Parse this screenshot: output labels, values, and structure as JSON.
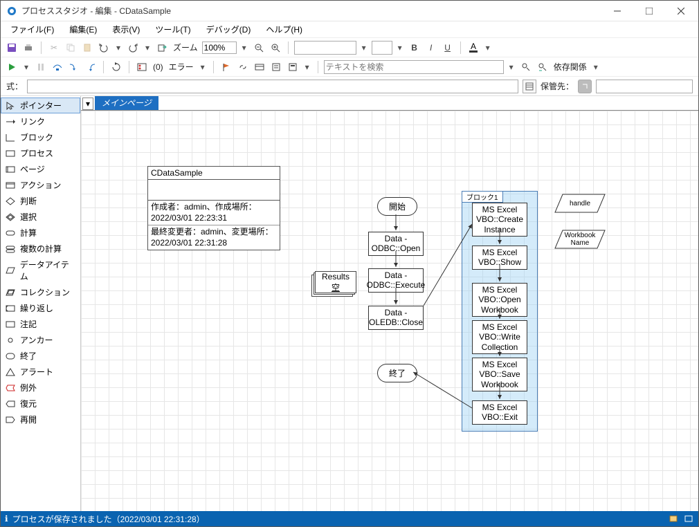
{
  "window": {
    "title": "プロセススタジオ - 編集 - CDataSample"
  },
  "menus": {
    "file": "ファイル(F)",
    "edit": "編集(E)",
    "view": "表示(V)",
    "tool": "ツール(T)",
    "debug": "デバッグ(D)",
    "help": "ヘルプ(H)"
  },
  "toolbar1": {
    "zoom_label": "ズーム",
    "zoom_value": "100%"
  },
  "toolbar2": {
    "bp_label": "(0)",
    "error_label": "エラー",
    "search_placeholder": "テキストを検索",
    "depend_label": "依存関係"
  },
  "exprbar": {
    "expr_label": "式：",
    "storage_label": "保管先："
  },
  "toolbox": {
    "items": [
      {
        "label": "ポインター",
        "selected": true
      },
      {
        "label": "リンク"
      },
      {
        "label": "ブロック"
      },
      {
        "label": "プロセス"
      },
      {
        "label": "ページ"
      },
      {
        "label": "アクション"
      },
      {
        "label": "判断"
      },
      {
        "label": "選択"
      },
      {
        "label": "計算"
      },
      {
        "label": "複数の計算"
      },
      {
        "label": "データアイテム"
      },
      {
        "label": "コレクション"
      },
      {
        "label": "繰り返し"
      },
      {
        "label": "注記"
      },
      {
        "label": "アンカー"
      },
      {
        "label": "終了"
      },
      {
        "label": "アラート"
      },
      {
        "label": "例外"
      },
      {
        "label": "復元"
      },
      {
        "label": "再開"
      }
    ]
  },
  "tabs": {
    "main": "メインページ"
  },
  "process_info": {
    "title": "CDataSample",
    "created_label": "作成者：admin、作成場所：",
    "created_at": "2022/03/01 22:23:31",
    "modified_label": "最終変更者：admin、変更場所：",
    "modified_at": "2022/03/01 22:31:28"
  },
  "flow": {
    "start": "開始",
    "end": "終了",
    "odbc_open": "Data - ODBC::Open",
    "odbc_exec": "Data - ODBC::Execute",
    "oledb_close": "Data - OLEDB::Close",
    "block_label": "ブロック1",
    "excel_create": "MS Excel VBO::Create Instance",
    "excel_show": "MS Excel VBO::Show",
    "excel_open": "MS Excel VBO::Open Workbook",
    "excel_write": "MS Excel VBO::Write Collection",
    "excel_save": "MS Excel VBO::Save Workbook",
    "excel_exit": "MS Excel VBO::Exit",
    "collection_name": "Results",
    "collection_state": "空",
    "data_handle": "handle",
    "data_workbook": "Workbook Name"
  },
  "status": {
    "message": "プロセスが保存されました（2022/03/01 22:31:28）"
  }
}
